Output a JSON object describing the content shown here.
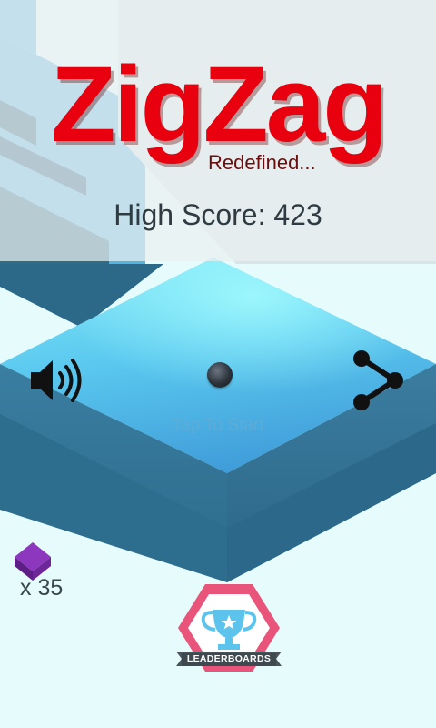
{
  "game": {
    "title": "ZigZag",
    "subtitle": "Redefined...",
    "high_score_label": "High Score:",
    "high_score": "423",
    "hint": "Tap To Start",
    "gem_count": "x 35",
    "leaderboards_label": "LEADERBOARDS"
  },
  "icons": {
    "sound": "speaker-icon",
    "share": "share-icon",
    "gem": "gem-icon",
    "trophy": "trophy-icon"
  },
  "colors": {
    "title": "#e8000e",
    "platform_top": "#4fc3f0",
    "platform_side": "#2f6f8c",
    "wall_dark": "#2a5b72",
    "gem": "#8a2fb8",
    "badge": "#e8547a"
  }
}
